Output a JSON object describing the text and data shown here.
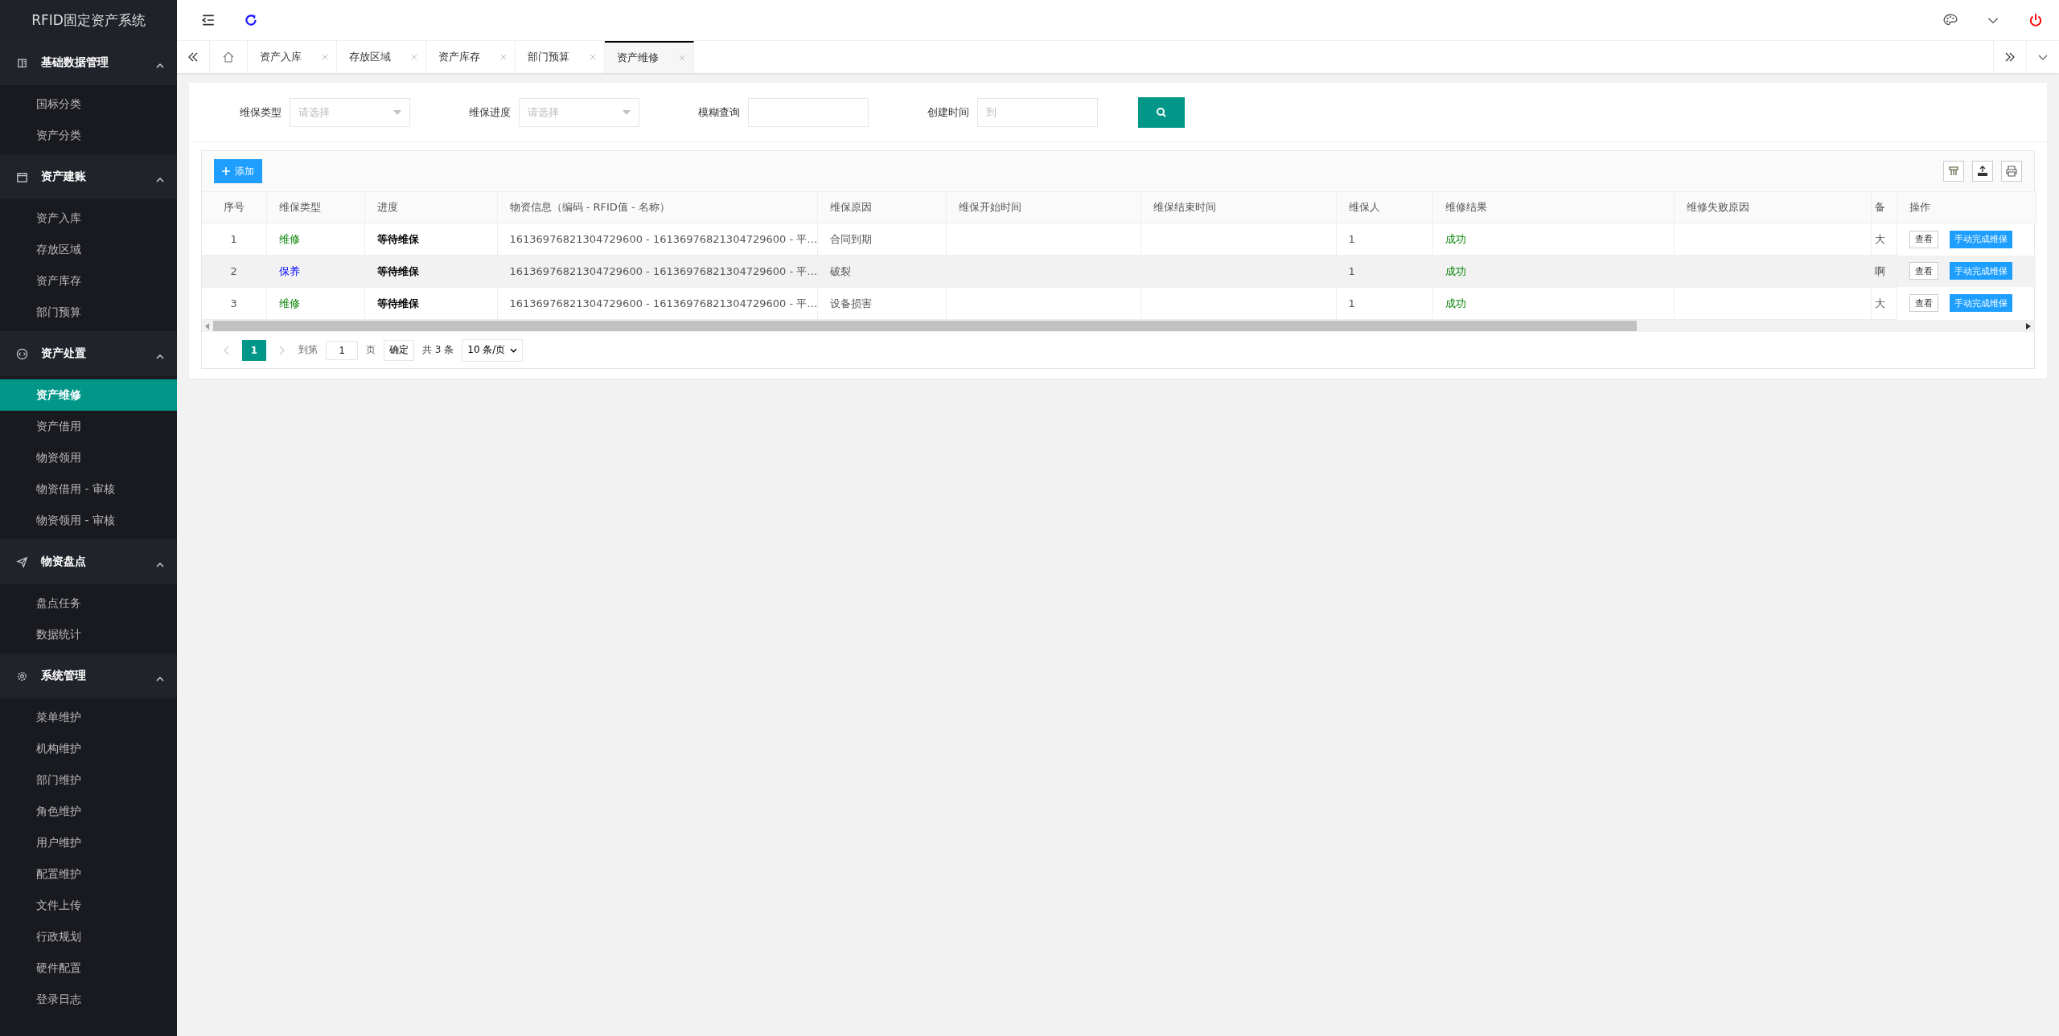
{
  "app_title": "RFID固定资产系统",
  "sidebar": {
    "groups": [
      {
        "label": "基础数据管理",
        "expanded": true,
        "items": [
          {
            "label": "国标分类",
            "selected": false
          },
          {
            "label": "资产分类",
            "selected": false
          }
        ]
      },
      {
        "label": "资产建账",
        "expanded": true,
        "items": [
          {
            "label": "资产入库",
            "selected": false
          },
          {
            "label": "存放区域",
            "selected": false
          },
          {
            "label": "资产库存",
            "selected": false
          },
          {
            "label": "部门预算",
            "selected": false
          }
        ]
      },
      {
        "label": "资产处置",
        "expanded": true,
        "items": [
          {
            "label": "资产维修",
            "selected": true
          },
          {
            "label": "资产借用",
            "selected": false
          },
          {
            "label": "物资领用",
            "selected": false
          },
          {
            "label": "物资借用 - 审核",
            "selected": false
          },
          {
            "label": "物资领用 - 审核",
            "selected": false
          }
        ]
      },
      {
        "label": "物资盘点",
        "expanded": true,
        "items": [
          {
            "label": "盘点任务",
            "selected": false
          },
          {
            "label": "数据统计",
            "selected": false
          }
        ]
      },
      {
        "label": "系统管理",
        "expanded": true,
        "items": [
          {
            "label": "菜单维护",
            "selected": false
          },
          {
            "label": "机构维护",
            "selected": false
          },
          {
            "label": "部门维护",
            "selected": false
          },
          {
            "label": "角色维护",
            "selected": false
          },
          {
            "label": "用户维护",
            "selected": false
          },
          {
            "label": "配置维护",
            "selected": false
          },
          {
            "label": "文件上传",
            "selected": false
          },
          {
            "label": "行政规划",
            "selected": false
          },
          {
            "label": "硬件配置",
            "selected": false
          },
          {
            "label": "登录日志",
            "selected": false
          }
        ]
      }
    ]
  },
  "tabs": [
    {
      "label": "资产入库",
      "selected": false
    },
    {
      "label": "存放区域",
      "selected": false
    },
    {
      "label": "资产库存",
      "selected": false
    },
    {
      "label": "部门预算",
      "selected": false
    },
    {
      "label": "资产维修",
      "selected": true
    }
  ],
  "filters": [
    {
      "label": "维保类型",
      "kind": "select",
      "placeholder": "请选择"
    },
    {
      "label": "维保进度",
      "kind": "select",
      "placeholder": "请选择"
    },
    {
      "label": "模糊查询",
      "kind": "input"
    },
    {
      "label": "创建时间",
      "kind": "input",
      "placeholder": "到"
    }
  ],
  "add_button": "添加",
  "table": {
    "columns": [
      "序号",
      "维保类型",
      "进度",
      "物资信息（编码 - RFID值 - 名称）",
      "维保原因",
      "维保开始时间",
      "维保结束时间",
      "维保人",
      "维修结果",
      "维修失败原因",
      "备",
      "操作"
    ],
    "rows": [
      {
        "selected": false,
        "index": "1",
        "type": {
          "text": "维修",
          "color": "#008000"
        },
        "progress": "等待维保",
        "info": "16136976821304729600 - 16136976821304729600 - 平…",
        "reason": "合同到期",
        "operator": "1",
        "result": "成功",
        "note": "大",
        "actions": [
          "查看",
          "手动完成维保"
        ]
      },
      {
        "selected": true,
        "index": "2",
        "type": {
          "text": "保养",
          "color": "#0000ff"
        },
        "progress": "等待维保",
        "info": "16136976821304729600 - 16136976821304729600 - 平…",
        "reason": "破裂",
        "operator": "1",
        "result": "成功",
        "note": "啊",
        "actions": [
          "查看",
          "手动完成维保"
        ]
      },
      {
        "selected": false,
        "index": "3",
        "type": {
          "text": "维修",
          "color": "#008000"
        },
        "progress": "等待维保",
        "info": "16136976821304729600 - 16136976821304729600 - 平…",
        "reason": "设备损害",
        "operator": "1",
        "result": "成功",
        "note": "大",
        "actions": [
          "查看",
          "手动完成维保"
        ]
      }
    ]
  },
  "pagination": {
    "pages": [
      {
        "label": "1",
        "selected": true
      }
    ],
    "goto_label": "到第",
    "goto_value": "1",
    "page_unit": "页",
    "confirm": "确定",
    "total": "共 3 条",
    "page_size": "10 条/页"
  }
}
